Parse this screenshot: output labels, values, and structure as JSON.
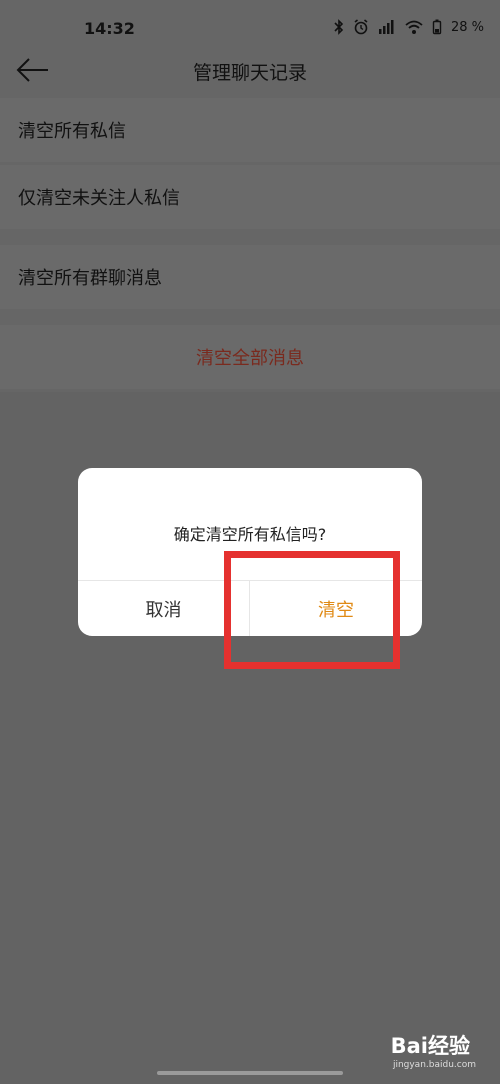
{
  "status_bar": {
    "time": "14:32",
    "battery": "28 %",
    "icons": [
      "bluetooth-icon",
      "alarm-icon",
      "signal-icon",
      "wifi-icon",
      "battery-icon"
    ]
  },
  "header": {
    "back_icon": "back-arrow-icon",
    "title": "管理聊天记录"
  },
  "menu": {
    "items": [
      {
        "label": "清空所有私信"
      },
      {
        "label": "仅清空未关注人私信"
      },
      {
        "label": "清空所有群聊消息"
      },
      {
        "label": "清空全部消息"
      }
    ]
  },
  "dialog": {
    "message": "确定清空所有私信吗?",
    "cancel_label": "取消",
    "confirm_label": "清空",
    "confirm_color": "#e08a15"
  },
  "annotation": {
    "color": "#e5312f"
  },
  "watermark": {
    "brand": "Bai经验",
    "url": "jingyan.baidu.com"
  }
}
